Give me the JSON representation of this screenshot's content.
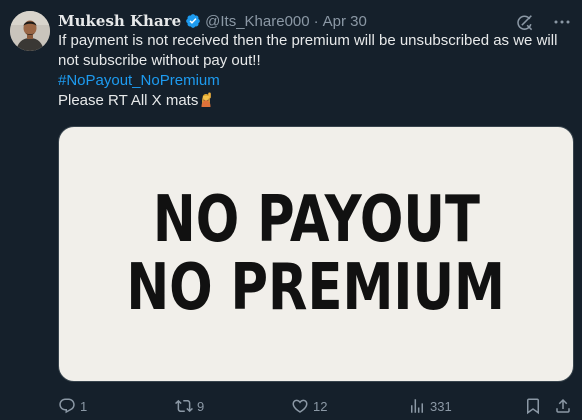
{
  "author": {
    "name": "Mukesh Khare",
    "handle": "@Its_Khare000",
    "separator": "·",
    "date": "Apr 30"
  },
  "post": {
    "text": "If payment is not received then the premium will be unsubscribed as we will not subscribe without pay out!!",
    "hashtag": "#NoPayout_NoPremium",
    "closing": "Please RT All X mats",
    "closing_emoji": "raising-hand-emoji"
  },
  "media": {
    "line1": "NO PAYOUT",
    "line2": "NO PREMIUM"
  },
  "actions": {
    "replies": "1",
    "reposts": "9",
    "likes": "12",
    "views": "331"
  },
  "colors": {
    "background": "#15202b",
    "text": "#e7e9ea",
    "muted": "#8b98a5",
    "link": "#1d9bf0",
    "verified": "#1d9bf0"
  }
}
